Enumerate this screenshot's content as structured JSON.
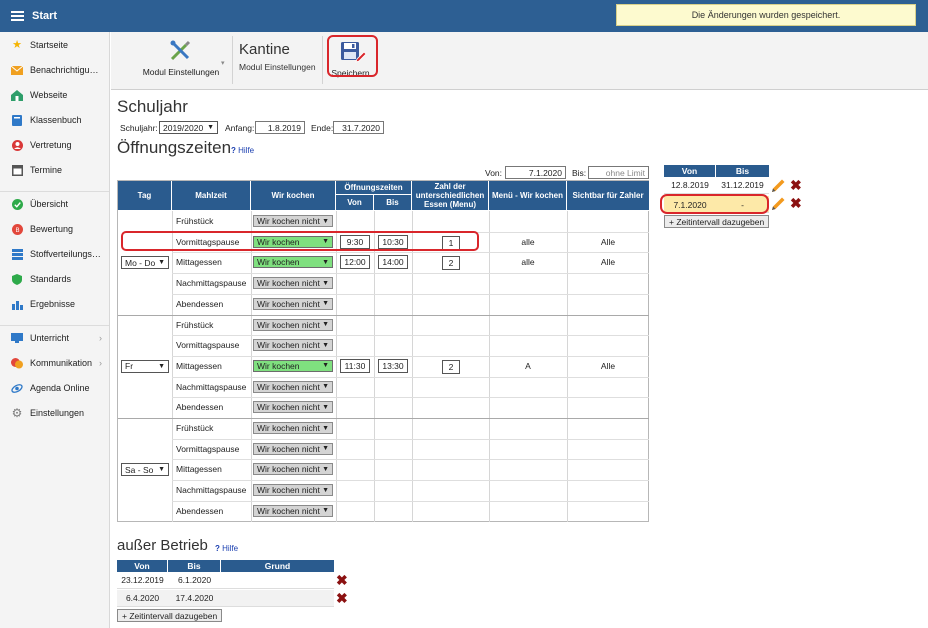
{
  "header": {
    "title": "Start",
    "notice": "Die Änderungen wurden gespeichert."
  },
  "sidebar": {
    "items": [
      {
        "label": "Startseite",
        "icon": "star-icon"
      },
      {
        "label": "Benachrichtigungen",
        "icon": "mail-icon"
      },
      {
        "label": "Webseite",
        "icon": "house-icon"
      },
      {
        "label": "Klassenbuch",
        "icon": "book-icon"
      },
      {
        "label": "Vertretung",
        "icon": "person-icon"
      },
      {
        "label": "Termine",
        "icon": "calendar-icon"
      },
      {
        "label": "Übersicht",
        "icon": "check-circle-icon"
      },
      {
        "label": "Bewertung",
        "icon": "rating-icon"
      },
      {
        "label": "Stoffverteilungsplan",
        "icon": "stack-icon"
      },
      {
        "label": "Standards",
        "icon": "shield-icon"
      },
      {
        "label": "Ergebnisse",
        "icon": "bar-chart-icon"
      },
      {
        "label": "Unterricht",
        "icon": "teaching-icon"
      },
      {
        "label": "Kommunikation",
        "icon": "chat-icon"
      },
      {
        "label": "Agenda Online",
        "icon": "globe-icon"
      },
      {
        "label": "Einstellungen",
        "icon": "gear-icon"
      }
    ]
  },
  "toolbar": {
    "modul_label": "Modul Einstellungen",
    "kantine_title": "Kantine",
    "kantine_sub": "Modul Einstellungen",
    "save_label": "Speichern"
  },
  "schuljahr": {
    "heading": "Schuljahr",
    "label": "Schuljahr:",
    "value": "2019/2020",
    "anfang_label": "Anfang:",
    "anfang": "1.8.2019",
    "ende_label": "Ende:",
    "ende": "31.7.2020"
  },
  "oeffnung": {
    "heading": "Öffnungszeiten",
    "help": "Hilfe",
    "von_label": "Von:",
    "von": "7.1.2020",
    "bis_label": "Bis:",
    "bis_placeholder": "ohne Limit",
    "columns": {
      "tag": "Tag",
      "mahlzeit": "Mahlzeit",
      "wir_kochen": "Wir kochen",
      "oeffnungszeiten": "Öffnungszeiten",
      "von": "Von",
      "bis": "Bis",
      "zahl": "Zahl der unterschiedlichen Essen (Menu)",
      "menue": "Menü - Wir kochen",
      "sichtbar": "Sichtbar für Zahler"
    },
    "groups": [
      {
        "day": "Mo - Do",
        "rows": [
          {
            "meal": "Frühstück",
            "status": "Wir kochen nicht",
            "active": false,
            "von": "",
            "bis": "",
            "count": "",
            "menu": "",
            "visible": ""
          },
          {
            "meal": "Vormittagspause",
            "status": "Wir kochen",
            "active": true,
            "von": "9:30",
            "bis": "10:30",
            "count": "1",
            "menu": "alle",
            "visible": "Alle"
          },
          {
            "meal": "Mittagessen",
            "status": "Wir kochen",
            "active": true,
            "von": "12:00",
            "bis": "14:00",
            "count": "2",
            "menu": "alle",
            "visible": "Alle"
          },
          {
            "meal": "Nachmittagspause",
            "status": "Wir kochen nicht",
            "active": false,
            "von": "",
            "bis": "",
            "count": "",
            "menu": "",
            "visible": ""
          },
          {
            "meal": "Abendessen",
            "status": "Wir kochen nicht",
            "active": false,
            "von": "",
            "bis": "",
            "count": "",
            "menu": "",
            "visible": ""
          }
        ]
      },
      {
        "day": "Fr",
        "rows": [
          {
            "meal": "Frühstück",
            "status": "Wir kochen nicht",
            "active": false,
            "von": "",
            "bis": "",
            "count": "",
            "menu": "",
            "visible": ""
          },
          {
            "meal": "Vormittagspause",
            "status": "Wir kochen nicht",
            "active": false,
            "von": "",
            "bis": "",
            "count": "",
            "menu": "",
            "visible": ""
          },
          {
            "meal": "Mittagessen",
            "status": "Wir kochen",
            "active": true,
            "von": "11:30",
            "bis": "13:30",
            "count": "2",
            "menu": "A",
            "visible": "Alle"
          },
          {
            "meal": "Nachmittagspause",
            "status": "Wir kochen nicht",
            "active": false,
            "von": "",
            "bis": "",
            "count": "",
            "menu": "",
            "visible": ""
          },
          {
            "meal": "Abendessen",
            "status": "Wir kochen nicht",
            "active": false,
            "von": "",
            "bis": "",
            "count": "",
            "menu": "",
            "visible": ""
          }
        ]
      },
      {
        "day": "Sa - So",
        "rows": [
          {
            "meal": "Frühstück",
            "status": "Wir kochen nicht",
            "active": false,
            "von": "",
            "bis": "",
            "count": "",
            "menu": "",
            "visible": ""
          },
          {
            "meal": "Vormittagspause",
            "status": "Wir kochen nicht",
            "active": false,
            "von": "",
            "bis": "",
            "count": "",
            "menu": "",
            "visible": ""
          },
          {
            "meal": "Mittagessen",
            "status": "Wir kochen nicht",
            "active": false,
            "von": "",
            "bis": "",
            "count": "",
            "menu": "",
            "visible": ""
          },
          {
            "meal": "Nachmittagspause",
            "status": "Wir kochen nicht",
            "active": false,
            "von": "",
            "bis": "",
            "count": "",
            "menu": "",
            "visible": ""
          },
          {
            "meal": "Abendessen",
            "status": "Wir kochen nicht",
            "active": false,
            "von": "",
            "bis": "",
            "count": "",
            "menu": "",
            "visible": ""
          }
        ]
      }
    ]
  },
  "intervals": {
    "col_von": "Von",
    "col_bis": "Bis",
    "rows": [
      {
        "von": "12.8.2019",
        "bis": "31.12.2019",
        "selected": false
      },
      {
        "von": "7.1.2020",
        "bis": "-",
        "selected": true
      }
    ],
    "add_label": "+ Zeitintervall dazugeben"
  },
  "ausser": {
    "heading": "außer Betrieb",
    "help": "Hilfe",
    "col_von": "Von",
    "col_bis": "Bis",
    "col_grund": "Grund",
    "rows": [
      {
        "von": "23.12.2019",
        "bis": "6.1.2020",
        "grund": ""
      },
      {
        "von": "6.4.2020",
        "bis": "17.4.2020",
        "grund": ""
      }
    ],
    "add_label": "+ Zeitintervall dazugeben"
  },
  "colors": {
    "header": "#2d5f93",
    "table_header": "#2a5b8e",
    "active_green": "#7fe07f",
    "highlight_red": "#d9262b",
    "delete_red": "#8b1111",
    "pencil_orange": "#f39a1e"
  }
}
